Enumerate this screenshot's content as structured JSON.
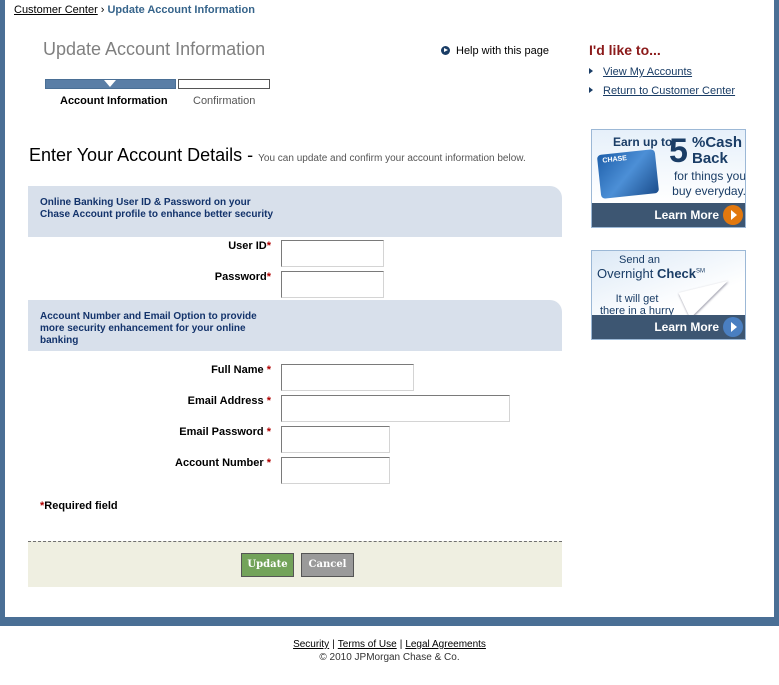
{
  "breadcrumb": {
    "home": "Customer Center",
    "separator": "›",
    "current": "Update Account Information"
  },
  "page": {
    "title": "Update Account Information",
    "help_link": "Help with this page"
  },
  "steps": [
    {
      "label": "Account Information",
      "active": true
    },
    {
      "label": "Confirmation",
      "active": false
    }
  ],
  "section": {
    "heading": "Enter Your Account Details",
    "dash": "-",
    "subheading": "You can update and confirm your account information below."
  },
  "panels": {
    "credentials": "Online Banking User ID & Password on your Chase Account profile to enhance better security",
    "account": "Account Number and Email Option to provide more security enhancement for your online banking"
  },
  "fields": {
    "user_id": {
      "label": "User ID",
      "required_mark": "*",
      "value": ""
    },
    "password": {
      "label": "Password",
      "required_mark": "*",
      "value": ""
    },
    "full_name": {
      "label": "Full Name",
      "required_mark": "*",
      "value": ""
    },
    "email_address": {
      "label": "Email Address",
      "required_mark": "*",
      "value": ""
    },
    "email_password": {
      "label": "Email Password",
      "required_mark": "*",
      "value": ""
    },
    "account_number": {
      "label": "Account Number",
      "required_mark": "*",
      "value": ""
    }
  },
  "required_note": {
    "mark": "*",
    "text": "Required field"
  },
  "buttons": {
    "update": "Update",
    "cancel": "Cancel"
  },
  "sidebar": {
    "title": "I'd like to...",
    "links": [
      "View My Accounts",
      "Return to Customer Center"
    ]
  },
  "ads": {
    "cashback": {
      "top": "Earn up to",
      "number": "5",
      "percent_cash": "%Cash",
      "back": "Back",
      "sub": "for things you buy everyday.",
      "card_logo": "CHASE",
      "cta": "Learn More",
      "icon": "arrow-circle-orange-icon"
    },
    "overnight": {
      "send": "Send an",
      "overnight": "Overnight",
      "check": "Check",
      "service_mark": "SM",
      "will": "It will get",
      "hurry": "there in a hurry",
      "cta": "Learn More",
      "icon": "arrow-circle-blue-icon"
    }
  },
  "footer": {
    "links": [
      "Security",
      "Terms of Use",
      "Legal Agreements"
    ],
    "separator": "|",
    "copyright": "© 2010 JPMorgan Chase & Co."
  },
  "colors": {
    "frame": "#4a6f95",
    "panel": "#d8e0eb",
    "panel_text": "#13336b",
    "required": "#b00000",
    "button_area": "#efefe1",
    "update_button": "#73a35a",
    "cancel_button": "#9a9a9a",
    "sidebar_title": "#8b1a1a"
  }
}
